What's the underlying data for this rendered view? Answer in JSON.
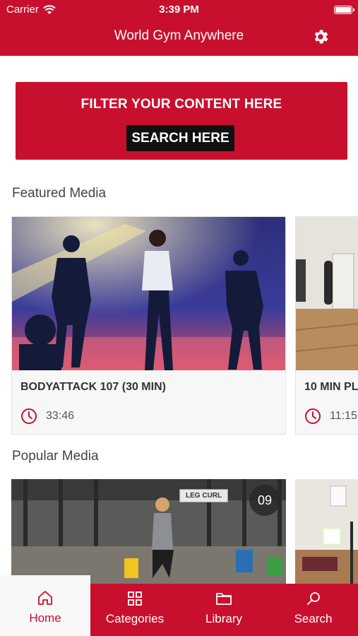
{
  "status_bar": {
    "carrier": "Carrier",
    "time": "3:39 PM"
  },
  "header": {
    "title": "World Gym Anywhere",
    "settings_icon": "gear-icon"
  },
  "filter": {
    "label": "FILTER YOUR CONTENT HERE",
    "button": "SEARCH HERE"
  },
  "featured": {
    "title": "Featured Media",
    "items": [
      {
        "title": "BODYATTACK 107 (30 MIN)",
        "duration": "33:46"
      },
      {
        "title": "10 MIN PL",
        "duration": "11:15"
      }
    ]
  },
  "popular": {
    "title": "Popular Media",
    "items": [
      {
        "badge": "09",
        "sign": "LEG CURL"
      },
      {}
    ]
  },
  "tabs": [
    {
      "label": "Home",
      "icon": "home-icon",
      "active": true
    },
    {
      "label": "Categories",
      "icon": "grid-icon",
      "active": false
    },
    {
      "label": "Library",
      "icon": "folder-icon",
      "active": false
    },
    {
      "label": "Search",
      "icon": "search-icon",
      "active": false
    }
  ],
  "colors": {
    "brand": "#c8102e",
    "button": "#111111"
  }
}
